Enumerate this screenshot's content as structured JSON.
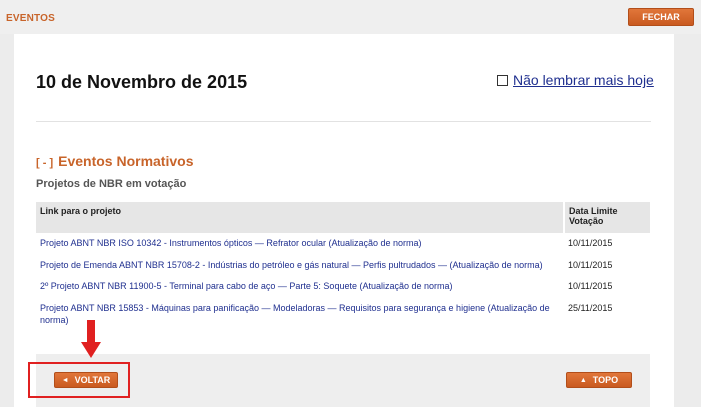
{
  "header": {
    "title": "EVENTOS",
    "close_label": "FECHAR"
  },
  "main": {
    "date": "10 de Novembro de 2015",
    "remember_label": "Não lembrar mais hoje",
    "toggle": "[ - ]",
    "section_title": "Eventos Normativos",
    "subtitle": "Projetos de NBR em votação"
  },
  "table": {
    "headers": [
      "Link para o projeto",
      "Data Limite Votação"
    ],
    "rows": [
      {
        "link": "Projeto ABNT NBR ISO 10342 - Instrumentos ópticos — Refrator ocular (Atualização de norma)",
        "date": "10/11/2015"
      },
      {
        "link": "Projeto de Emenda ABNT NBR 15708-2 - Indústrias do petróleo e gás natural — Perfis pultrudados — (Atualização de norma)",
        "date": "10/11/2015"
      },
      {
        "link": "2º Projeto ABNT NBR 11900-5 - Terminal para cabo de aço — Parte 5: Soquete (Atualização de norma)",
        "date": "10/11/2015"
      },
      {
        "link": "Projeto ABNT NBR 15853 - Máquinas para panificação — Modeladoras — Requisitos para segurança e higiene (Atualização de norma)",
        "date": "25/11/2015"
      }
    ]
  },
  "footer": {
    "back_label": "VOLTAR",
    "back_icon": "◄",
    "top_label": "TOPO",
    "top_icon": "▲"
  },
  "colors": {
    "accent": "#c8642a",
    "link": "#1f2f8f",
    "annotation": "#e02020"
  }
}
